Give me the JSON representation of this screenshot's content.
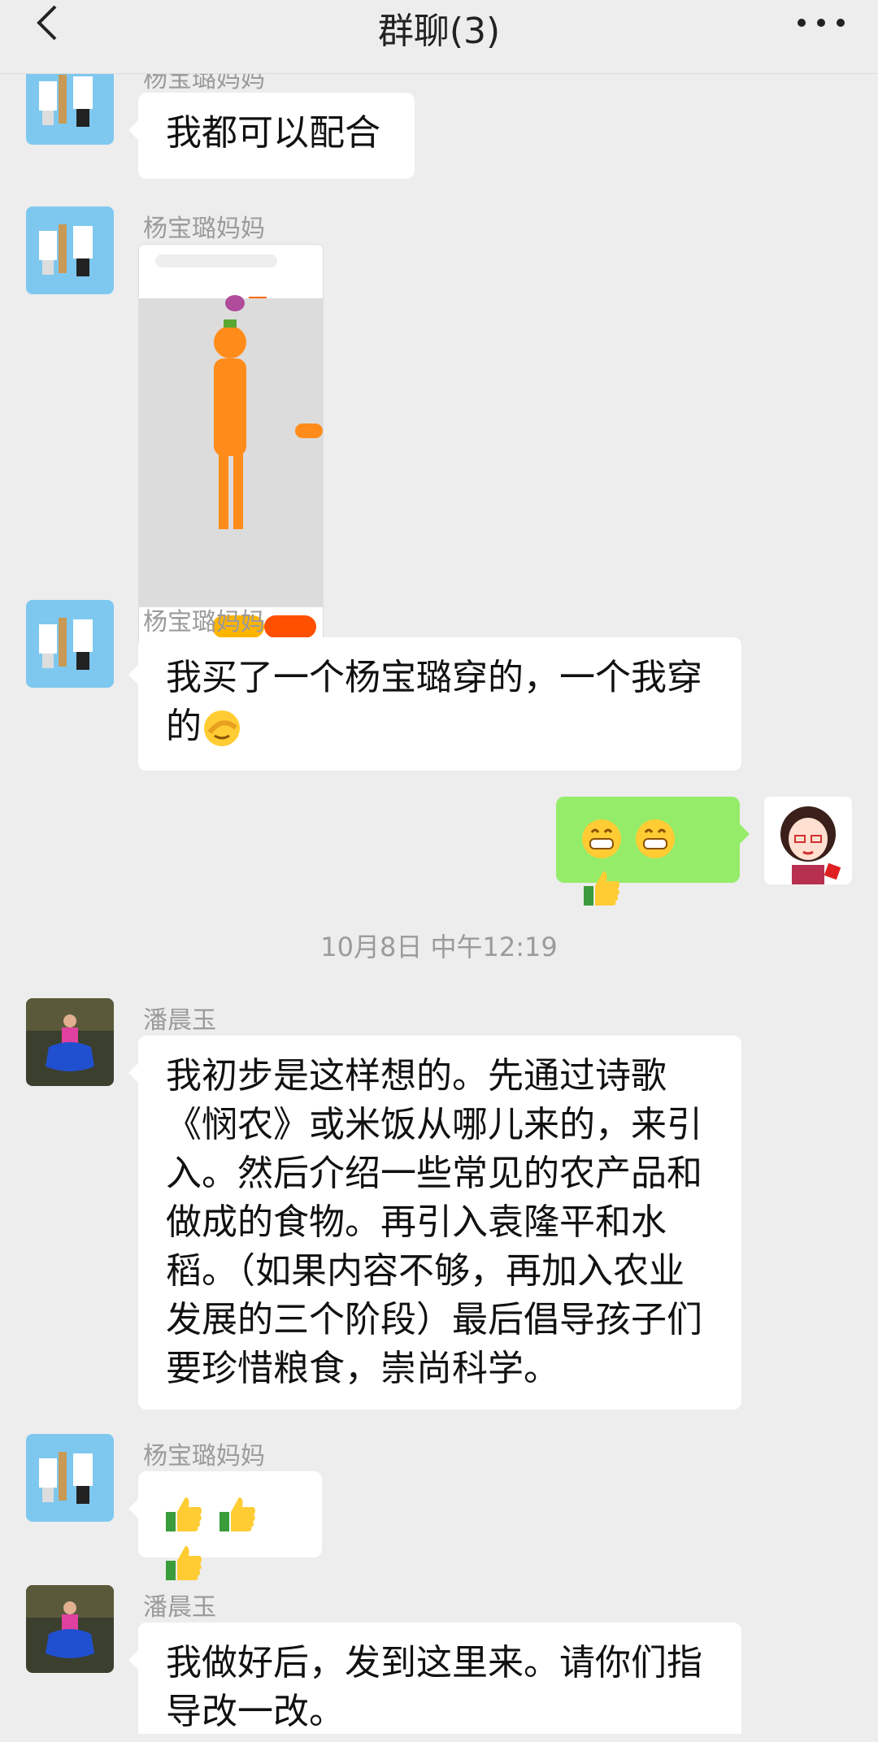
{
  "header": {
    "title": "群聊(3)"
  },
  "messages": [
    {
      "sender": "杨宝璐妈妈",
      "text": "我都可以配合"
    },
    {
      "sender": "杨宝璐妈妈",
      "type": "image"
    },
    {
      "sender": "杨宝璐妈妈",
      "text": "我买了一个杨宝璐穿的，一个我穿的"
    },
    {
      "sender": "me",
      "type": "emoji",
      "emojis": [
        "grin-icon",
        "grin-icon",
        "thumbs-up-icon"
      ]
    },
    {
      "timestamp": "10月8日 中午12:19"
    },
    {
      "sender": "潘晨玉",
      "text": "我初步是这样想的。先通过诗歌《悯农》或米饭从哪儿来的，来引入。然后介绍一些常见的农产品和做成的食物。再引入袁隆平和水稻。（如果内容不够，再加入农业发展的三个阶段）最后倡导孩子们要珍惜粮食，崇尚科学。"
    },
    {
      "sender": "杨宝璐妈妈",
      "type": "emoji",
      "emojis": [
        "thumbs-up-icon",
        "thumbs-up-icon",
        "thumbs-up-icon"
      ]
    },
    {
      "sender": "潘晨玉",
      "text": "我做好后，发到这里来。请你们指导改一改。"
    }
  ],
  "bubbles": {
    "m1": "我都可以配合",
    "m3_line1": "我买了一个杨宝璐穿的，一个我穿",
    "m3_line2": "的",
    "m5_line1": "我初步是这样想的。先通过诗歌",
    "m5_line2": "《悯农》或米饭从哪儿来的，来引",
    "m5_line3": "入。然后介绍一些常见的农产品和",
    "m5_line4": "做成的食物。再引入袁隆平和水",
    "m5_line5": "稻。（如果内容不够，再加入农业",
    "m5_line6": "发展的三个阶段）最后倡导孩子们",
    "m5_line7": "要珍惜粮食，崇尚科学。",
    "m7_line1": "我做好后，发到这里来。请你们指",
    "m7_line2": "导改一改。"
  },
  "names": {
    "yang": "杨宝璐妈妈",
    "pan": "潘晨玉"
  },
  "timestamp": "10月8日 中午12:19",
  "colors": {
    "background": "#ededed",
    "bubble_self": "#95ec69",
    "bubble_other": "#ffffff",
    "meta_text": "#9b9b9b"
  }
}
